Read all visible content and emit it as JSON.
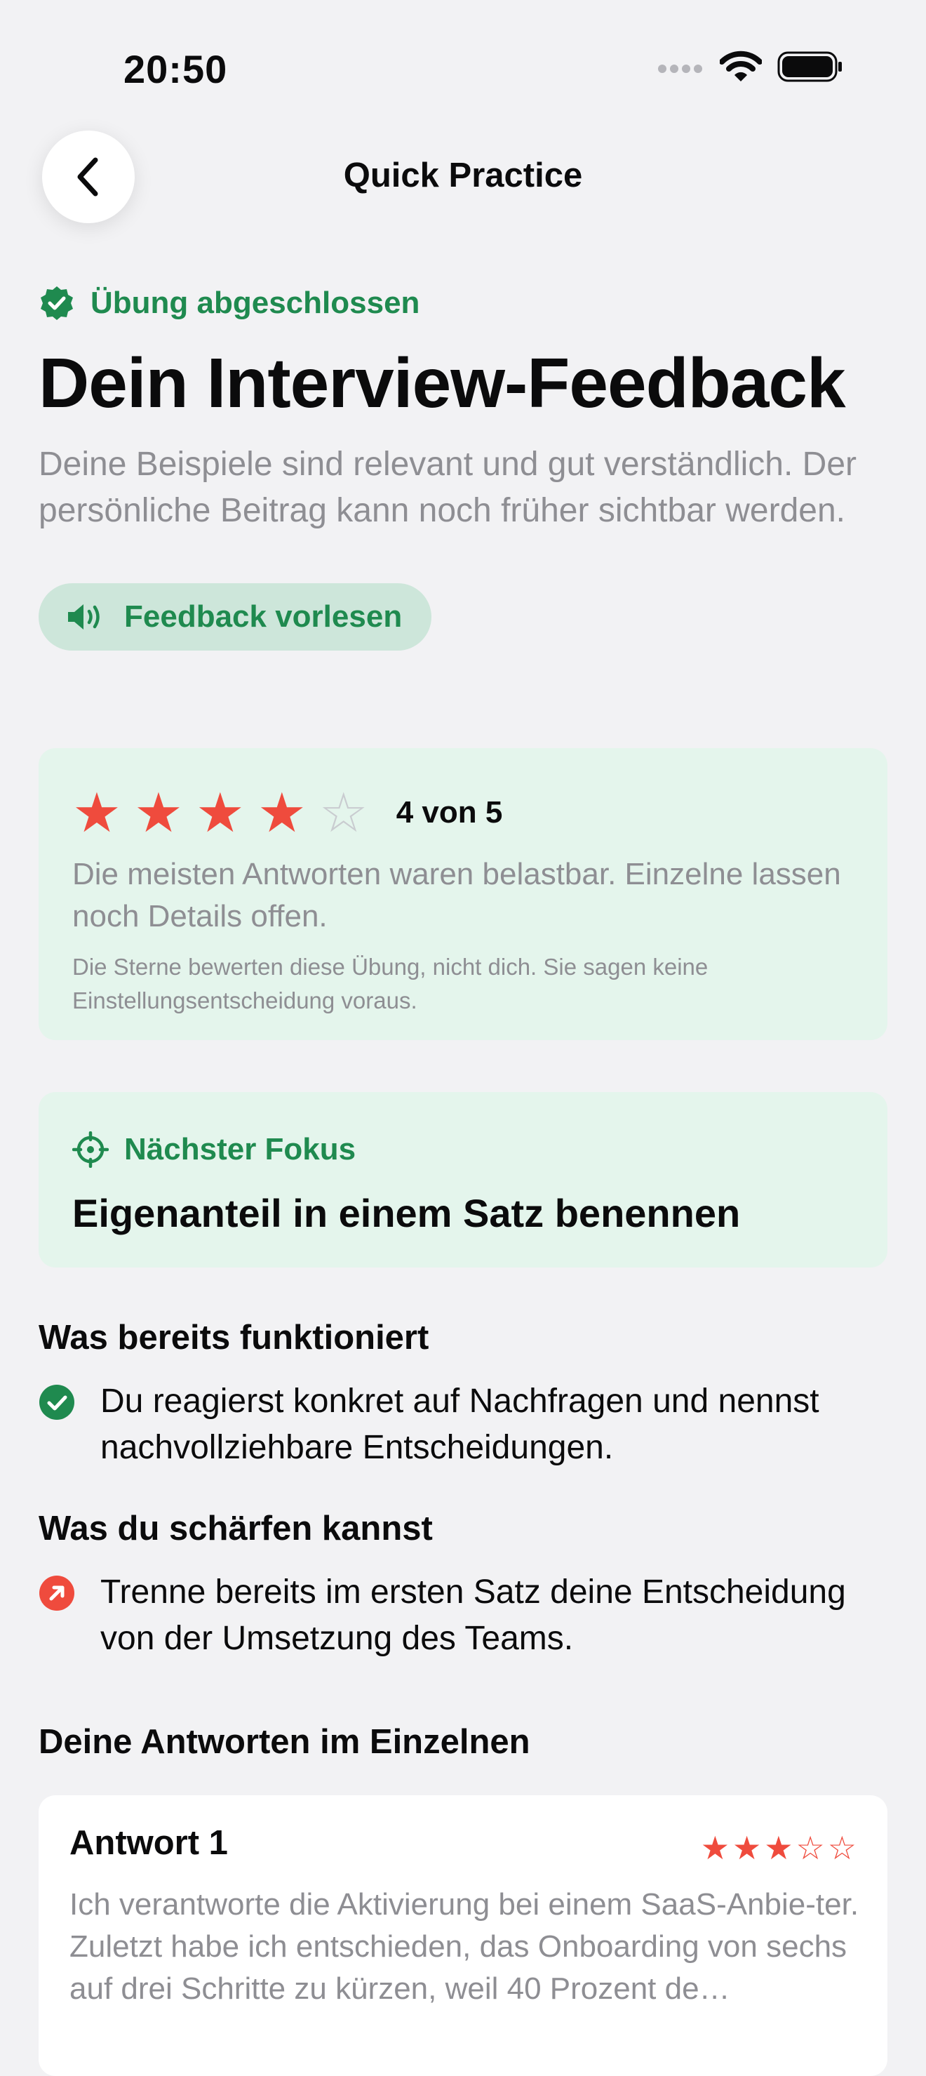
{
  "status": {
    "time": "20:50"
  },
  "nav": {
    "title": "Quick Practice"
  },
  "header": {
    "completed_label": "Übung abgeschlossen",
    "title": "Dein Interview-Feedback",
    "summary": "Deine Beispiele sind relevant und gut verständlich. Der persönliche Beitrag kann noch früher sichtbar werden.",
    "read_aloud_label": "Feedback vorlesen"
  },
  "rating": {
    "value": 4,
    "max": 5,
    "label": "4 von 5",
    "description": "Die meisten Antworten waren belastbar. Einzelne lassen noch Details offen.",
    "note": "Die Sterne bewerten diese Übung, nicht dich. Sie sagen keine Einstellungsentscheidung voraus."
  },
  "focus": {
    "label": "Nächster Fokus",
    "title": "Eigenanteil in einem Satz benennen"
  },
  "strengths": {
    "title": "Was bereits funktioniert",
    "text": "Du reagierst konkret auf Nachfragen und nennst nachvollziehbare Entscheidungen."
  },
  "improvements": {
    "title": "Was du schärfen kannst",
    "text": "Trenne bereits im ersten Satz deine Entscheidung von der Umsetzung des Teams."
  },
  "answers": {
    "title": "Deine Antworten im Einzelnen",
    "items": [
      {
        "title": "Antwort 1",
        "rating": 3,
        "max": 5,
        "text": "Ich verantworte die Aktivierung bei einem SaaS-Anbie-ter. Zuletzt habe ich entschieden, das Onboarding von sechs auf drei Schritte zu kürzen, weil 40 Prozent de…"
      }
    ]
  },
  "colors": {
    "accent_green": "#1f8a4f",
    "star_red": "#ef4b3d",
    "card_green": "#e4f5ec",
    "background": "#f2f2f4"
  }
}
